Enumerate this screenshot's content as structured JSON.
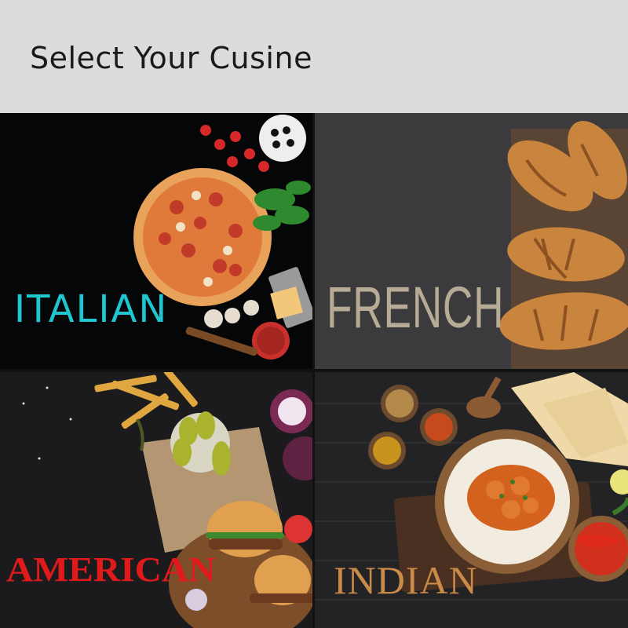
{
  "header": {
    "title": "Select Your Cusine"
  },
  "cuisines": [
    {
      "label": "ITALIAN"
    },
    {
      "label": "FRENCH"
    },
    {
      "label": "AMERICAN"
    },
    {
      "label": "INDIAN"
    }
  ],
  "colors": {
    "header_bg": "#dcdcdc",
    "italian_label": "#1ec7cf",
    "french_label": "#b8ab96",
    "american_label": "#e01a1a",
    "indian_label": "#c98a4a"
  }
}
